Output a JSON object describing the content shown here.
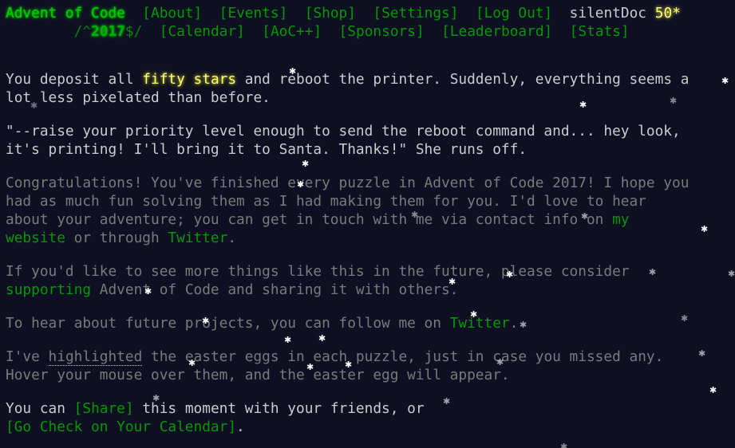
{
  "header": {
    "title": "Advent of Code",
    "nav_row1": [
      "[About]",
      "[Events]",
      "[Shop]",
      "[Settings]",
      "[Log Out]"
    ],
    "username": "silentDoc",
    "star_count": "50*",
    "year_prefix": "/^",
    "year": "2017",
    "year_suffix": "$/",
    "nav_row2": [
      "[Calendar]",
      "[AoC++]",
      "[Sponsors]",
      "[Leaderboard]",
      "[Stats]"
    ]
  },
  "main": {
    "p1_a": "You deposit all ",
    "p1_gold": "fifty stars",
    "p1_b": " and reboot the printer. Suddenly, everything seems a lot less pixelated than before.",
    "p2": "\"--raise your priority level enough to send the reboot command and... hey look, it's printing! I'll bring it to Santa. Thanks!\" She runs off.",
    "p3_a": "Congratulations! You've finished every puzzle in Advent of Code 2017! I hope you had as much fun solving them as I had making them for you. I'd love to hear about your adventure; you can get in touch with me via contact info on ",
    "p3_link1": "my website",
    "p3_b": " or through ",
    "p3_link2": "Twitter",
    "p3_c": ".",
    "p4_a": "If you'd like to see more things like this in the future, please consider ",
    "p4_link": "supporting",
    "p4_b": " Advent of Code and sharing it with others.",
    "p5_a": "To hear about future projects, you can follow me on ",
    "p5_link": "Twitter",
    "p5_b": ".",
    "p6_a": "I've ",
    "p6_highlight": "highlighted",
    "p6_b": " the easter eggs in each puzzle, just in case you missed any. Hover your mouse over them, and the easter egg will appear.",
    "p7_a": "You can ",
    "p7_share": "[Share]",
    "p7_b": " this moment with your friends, or",
    "p7_calendar": "[Go Check on Your Calendar]",
    "p7_c": "."
  },
  "colors": {
    "background": "#0f0f23",
    "text": "#cccccc",
    "dim_text": "#7a7a7a",
    "link": "#009900",
    "title": "#00cc00",
    "gold": "#ffff66"
  }
}
